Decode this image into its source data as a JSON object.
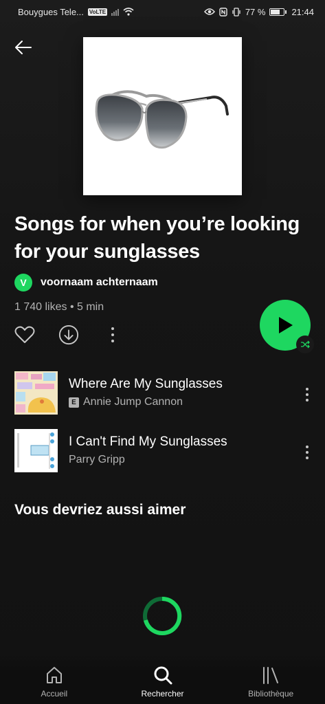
{
  "status_bar": {
    "carrier": "Bouygues Tele...",
    "volte": "VoLTE",
    "battery": "77 %",
    "time": "21:44"
  },
  "playlist": {
    "title": "Songs for when you’re looking for  your  sunglasses",
    "owner_initial": "V",
    "owner_name": "voornaam achternaam",
    "meta": "1 740 likes • 5 min"
  },
  "tracks": [
    {
      "title": "Where Are My Sunglasses",
      "artist": "Annie Jump Cannon",
      "explicit": true,
      "explicit_label": "E"
    },
    {
      "title": "I Can't Find My Sunglasses",
      "artist": "Parry Gripp",
      "explicit": false
    }
  ],
  "section_title": "Vous devriez aussi aimer",
  "nav": {
    "home": "Accueil",
    "search": "Rechercher",
    "library": "Bibliothèque"
  },
  "colors": {
    "accent": "#1ed760",
    "background": "#121212",
    "secondary_text": "#b3b3b3"
  },
  "icons": [
    "back-arrow-icon",
    "heart-icon",
    "download-icon",
    "more-icon",
    "play-icon",
    "shuffle-icon",
    "home-icon",
    "search-icon",
    "library-icon"
  ]
}
